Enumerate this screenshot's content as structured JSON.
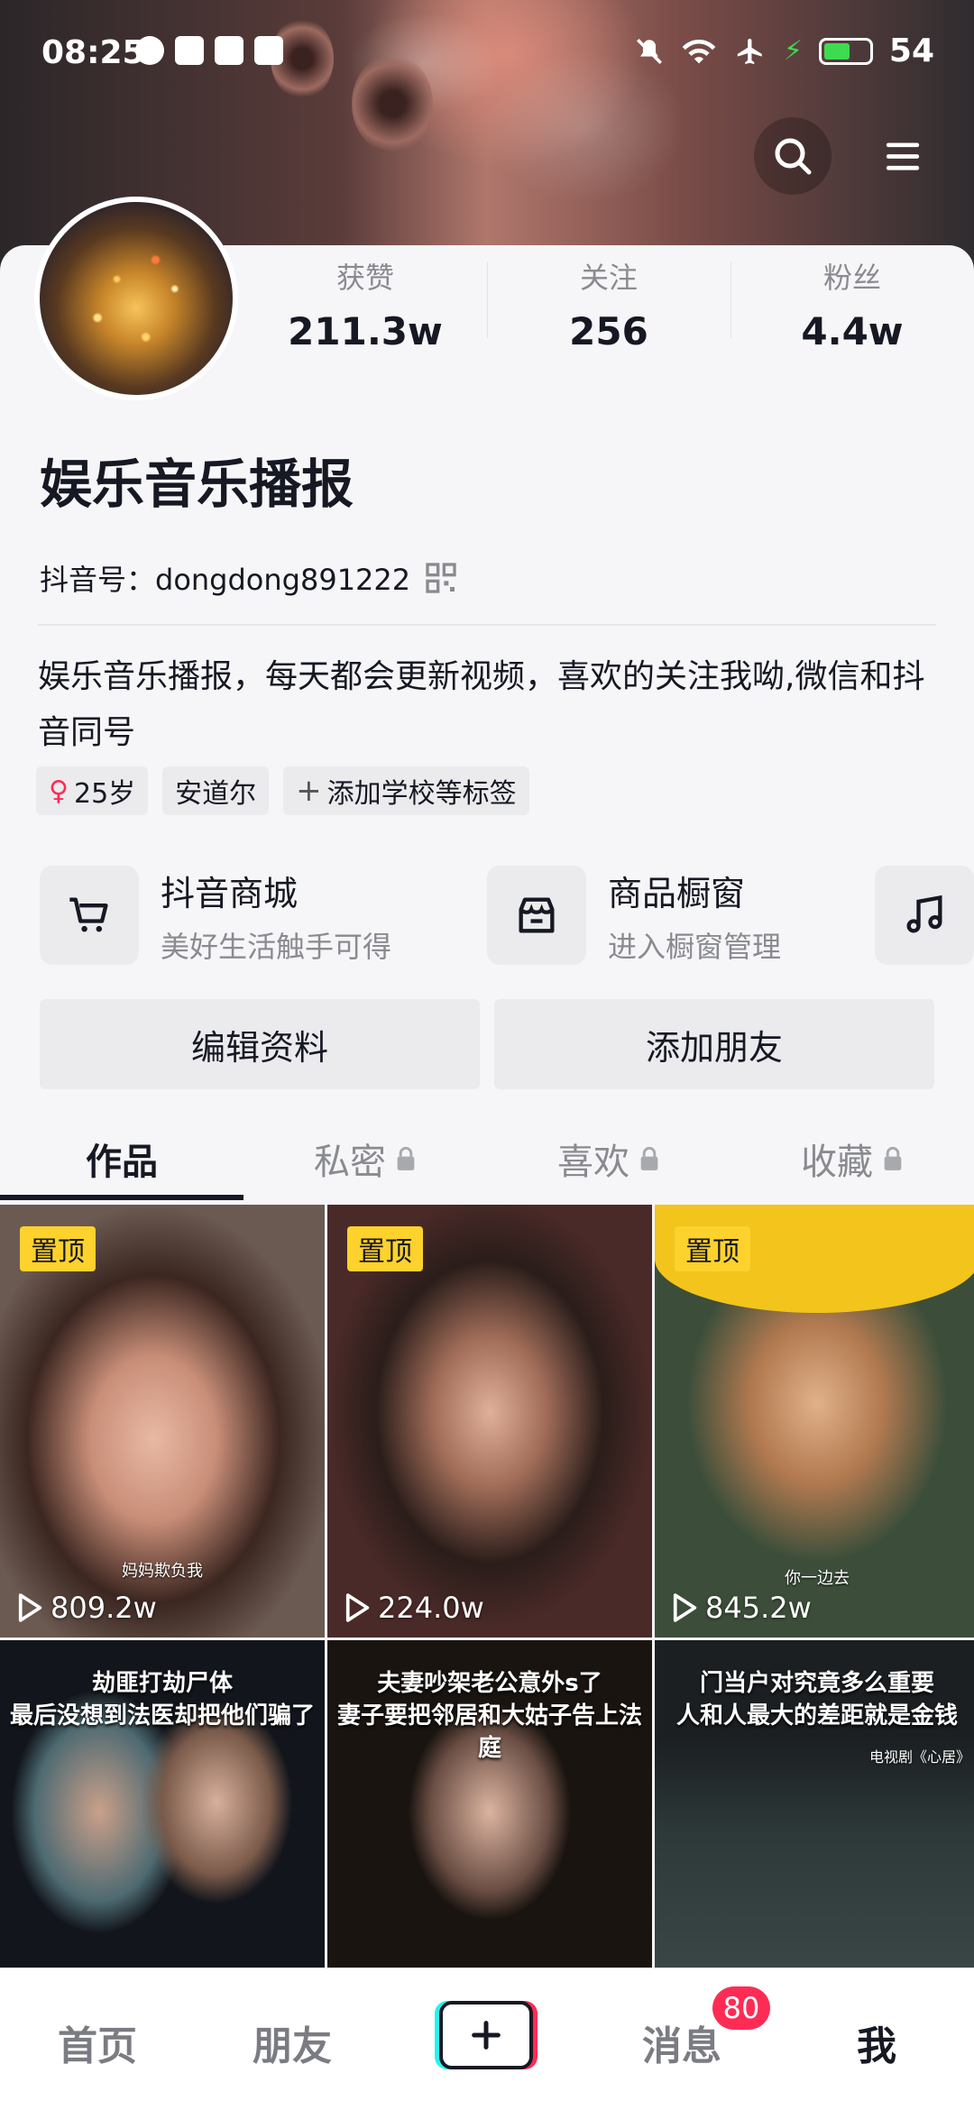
{
  "status_bar": {
    "time": "08:25",
    "battery": "54"
  },
  "profile": {
    "stats": [
      {
        "label": "获赞",
        "value": "211.3w"
      },
      {
        "label": "关注",
        "value": "256"
      },
      {
        "label": "粉丝",
        "value": "4.4w"
      }
    ],
    "name": "娱乐音乐播报",
    "douyin_id": "抖音号：dongdong891222",
    "bio": "娱乐音乐播报，每天都会更新视频，喜欢的关注我呦,微信和抖音同号",
    "tags": [
      "25岁",
      "安道尔",
      "添加学校等标签"
    ]
  },
  "services": [
    {
      "title": "抖音商城",
      "subtitle": "美好生活触手可得",
      "icon": "cart-icon"
    },
    {
      "title": "商品橱窗",
      "subtitle": "进入橱窗管理",
      "icon": "shop-icon"
    },
    {
      "title": "",
      "subtitle": "",
      "icon": "music-icon"
    }
  ],
  "actions": {
    "edit": "编辑资料",
    "add_friend": "添加朋友"
  },
  "tabs": [
    {
      "label": "作品",
      "locked": false
    },
    {
      "label": "私密",
      "locked": true
    },
    {
      "label": "喜欢",
      "locked": true
    },
    {
      "label": "收藏",
      "locked": true
    }
  ],
  "videos": [
    {
      "pinned": "置顶",
      "plays": "809.2w",
      "caption": "妈妈欺负我"
    },
    {
      "pinned": "置顶",
      "plays": "224.0w",
      "caption": ""
    },
    {
      "pinned": "置顶",
      "plays": "845.2w",
      "caption": "你一边去"
    },
    {
      "overlay_line1": "劫匪打劫尸体",
      "overlay_line2": "最后没想到法医却把他们骗了"
    },
    {
      "overlay_line1": "夫妻吵架老公意外s了",
      "overlay_line2": "妻子要把邻居和大姑子告上法庭"
    },
    {
      "overlay_line1": "门当户对究竟多么重要",
      "overlay_line2": "人和人最大的差距就是金钱",
      "corner": "电视剧《心居》"
    }
  ],
  "bottom_nav": {
    "home": "首页",
    "friends": "朋友",
    "messages": "消息",
    "messages_badge": "80",
    "me": "我"
  },
  "colors": {
    "accent_red": "#fe2c55",
    "accent_cyan": "#25f4ee",
    "pin_yellow": "#fdd22c",
    "text_primary": "#161823",
    "text_secondary": "#8a8b91"
  }
}
